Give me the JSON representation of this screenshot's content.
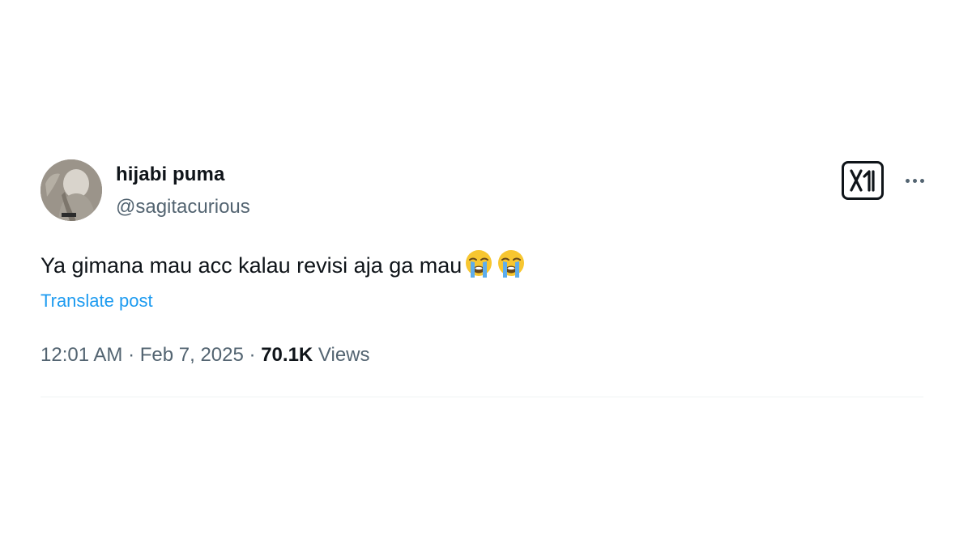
{
  "tweet": {
    "display_name": "hijabi puma",
    "handle": "@sagitacurious",
    "text": "Ya gimana mau acc kalau revisi aja ga mau",
    "emojis": [
      "loudly-crying-face",
      "loudly-crying-face"
    ],
    "translate_label": "Translate post",
    "time": "12:01 AM",
    "separator": "·",
    "date": "Feb 7, 2025",
    "views_count": "70.1K",
    "views_label": "Views"
  },
  "icons": {
    "brand": "x-logo-icon",
    "more": "more-options-icon",
    "avatar": "profile-avatar"
  },
  "colors": {
    "text_primary": "#0f1419",
    "text_secondary": "#536471",
    "link": "#1d9bf0",
    "divider": "#eff3f4",
    "background": "#ffffff"
  }
}
